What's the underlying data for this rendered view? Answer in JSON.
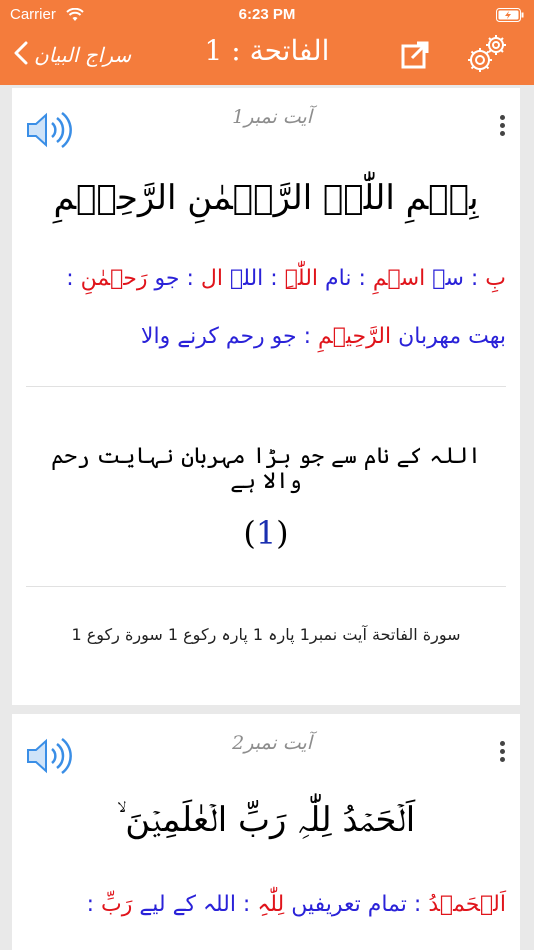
{
  "status_bar": {
    "carrier": "Carrier",
    "time": "6:23 PM"
  },
  "nav": {
    "back_label": "سراج البیان",
    "title": "الفاتحة : 1"
  },
  "ayahs": [
    {
      "ayah_label": "آیت نمبر1",
      "arabic": "بِسۡمِ اللّٰہِ الرَّحۡمٰنِ الرَّحِیۡمِ",
      "wbw_line1": [
        {
          "text": "بِ",
          "color": "red"
        },
        {
          "text": " : سے ",
          "color": "blue"
        },
        {
          "text": "اسۡمِ",
          "color": "red"
        },
        {
          "text": " : نام ",
          "color": "blue"
        },
        {
          "text": "اللّٰہِ",
          "color": "red"
        },
        {
          "text": " : اللہ ",
          "color": "blue"
        },
        {
          "text": "ال",
          "color": "red"
        },
        {
          "text": " : جو ",
          "color": "blue"
        },
        {
          "text": "رَحۡمٰنِ",
          "color": "red"
        },
        {
          "text": " :",
          "color": "blue"
        }
      ],
      "wbw_line2": [
        {
          "text": "بھت مھربان ",
          "color": "blue"
        },
        {
          "text": "الرَّحِیۡمِ",
          "color": "red"
        },
        {
          "text": " : جو رحم کرنے والا",
          "color": "blue"
        }
      ],
      "translation": "اللہ کے نام سے جو بڑا مہربان نہایت رحم والا ہے",
      "verse_number": "1",
      "reference": "سورة الفاتحة آیت نمبر1 پارہ 1 پارہ رکوع 1 سورة رکوع 1"
    },
    {
      "ayah_label": "آیت نمبر2",
      "arabic": "اَلۡحَمۡدُ لِلّٰہِ رَبِّ الۡعٰلَمِیۡنَ ۙ",
      "wbw_line1": [
        {
          "text": "اَلۡحَمۡدُ",
          "color": "red"
        },
        {
          "text": " : تمام تعریفیں ",
          "color": "blue"
        },
        {
          "text": "لِلّٰہِ",
          "color": "red"
        },
        {
          "text": " : اللہ کے لیے ",
          "color": "blue"
        },
        {
          "text": "رَبِّ",
          "color": "red"
        },
        {
          "text": " :",
          "color": "blue"
        }
      ]
    }
  ],
  "colors": {
    "header": "#f47c3c",
    "arabic_word": "#e0141b",
    "meaning": "#2a22d8",
    "verse_number": "#1a2fb0"
  },
  "icons": [
    "wifi-icon",
    "battery-icon",
    "chevron-left-icon",
    "share-icon",
    "gear-icon",
    "speaker-icon",
    "more-vertical-icon"
  ]
}
